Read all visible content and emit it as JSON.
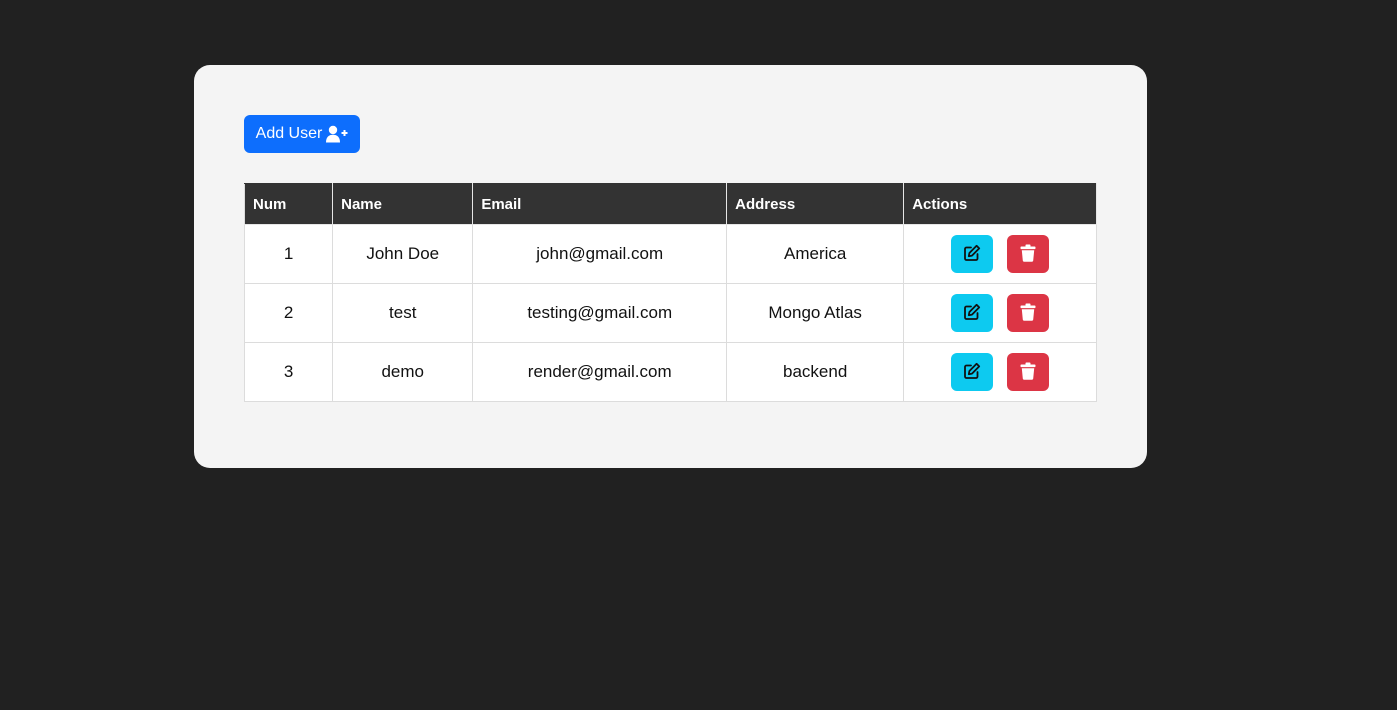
{
  "toolbar": {
    "add_user_label": "Add User",
    "add_user_icon": "user-plus-icon"
  },
  "table": {
    "headers": {
      "num": "Num",
      "name": "Name",
      "email": "Email",
      "address": "Address",
      "actions": "Actions"
    },
    "rows": [
      {
        "num": "1",
        "name": "John Doe",
        "email": "john@gmail.com",
        "address": "America"
      },
      {
        "num": "2",
        "name": "test",
        "email": "testing@gmail.com",
        "address": "Mongo Atlas"
      },
      {
        "num": "3",
        "name": "demo",
        "email": "render@gmail.com",
        "address": "backend"
      }
    ],
    "row_actions": {
      "edit_icon": "edit-icon",
      "delete_icon": "trash-icon"
    }
  },
  "colors": {
    "page_background": "#212121",
    "card_background": "#f4f4f4",
    "primary": "#0d6efd",
    "info": "#0dcaf0",
    "danger": "#dc3545",
    "table_header": "#333333"
  }
}
